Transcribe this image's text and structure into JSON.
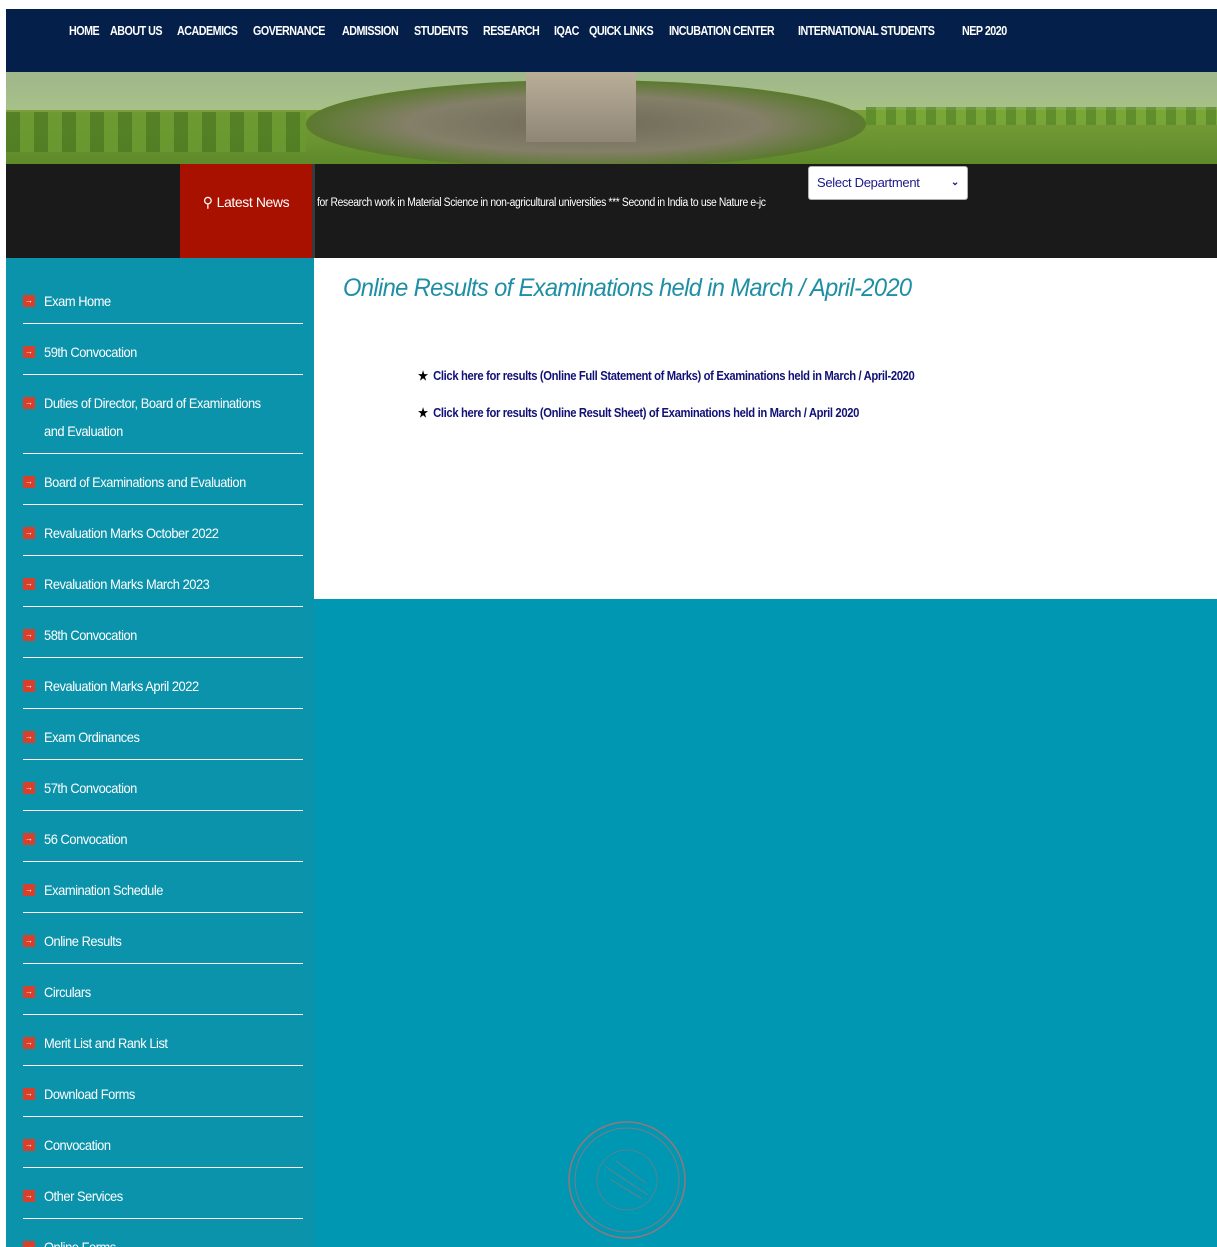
{
  "nav": {
    "items": [
      "HOME",
      "ABOUT US",
      "ACADEMICS",
      "GOVERNANCE",
      "ADMISSION",
      "STUDENTS",
      "RESEARCH",
      "IQAC",
      "QUICK LINKS",
      "INCUBATION CENTER",
      "INTERNATIONAL STUDENTS",
      "NEP 2020"
    ]
  },
  "news": {
    "label": "Latest News",
    "ticker": "for Research work in Material Science in non-agricultural universities *** Second in India to use Nature e-jc",
    "department_select": "Select Department"
  },
  "sidebar": {
    "items": [
      "Exam Home",
      "59th Convocation",
      "Duties of Director, Board of Examinations and Evaluation",
      "Board of Examinations and Evaluation",
      "Revaluation Marks October 2022",
      "Revaluation Marks March 2023",
      "58th Convocation",
      "Revaluation Marks April 2022",
      "Exam Ordinances",
      "57th Convocation",
      "56 Convocation",
      "Examination Schedule",
      "Online Results",
      "Circulars",
      "Merit List and Rank List",
      "Download Forms",
      "Convocation",
      "Other Services",
      "Online Forms"
    ]
  },
  "main": {
    "title": "Online Results of Examinations held in March / April-2020",
    "links": [
      "Click here for results (Online Full Statement of Marks) of Examinations held in March / April-2020",
      "Click here for results (Online Result Sheet) of Examinations held in March / April 2020"
    ]
  },
  "colors": {
    "nav_bg": "#04204a",
    "news_label_bg": "#a81000",
    "sidebar_bg": "#0b93ac",
    "content_bg": "#0097b2",
    "title_color": "#1f8fa6",
    "link_color": "#111177",
    "bullet_color": "#d9402c"
  },
  "icons": {
    "news": "pin-icon",
    "sidebar_bullet": "arrow-right-icon",
    "link_bullet": "star-icon",
    "select": "chevron-down-icon"
  }
}
